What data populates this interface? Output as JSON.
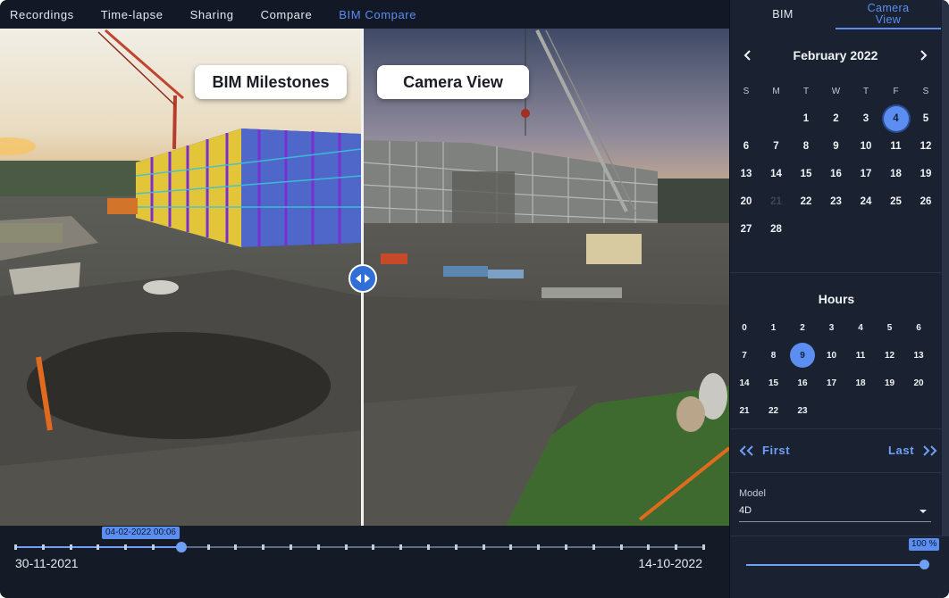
{
  "topnav": {
    "tabs": [
      {
        "label": "Recordings"
      },
      {
        "label": "Time-lapse"
      },
      {
        "label": "Sharing"
      },
      {
        "label": "Compare"
      },
      {
        "label": "BIM Compare",
        "active": true
      }
    ]
  },
  "viewer": {
    "left_label": "BIM Milestones",
    "right_label": "Camera View"
  },
  "timeline": {
    "current": "04-02-2022 00:06",
    "start": "30-11-2021",
    "end": "14-10-2022"
  },
  "panel": {
    "tabs": [
      {
        "label": "BIM"
      },
      {
        "label": "Camera View",
        "active": true
      }
    ],
    "calendar": {
      "month": "February 2022",
      "weekdays": [
        "S",
        "M",
        "T",
        "W",
        "T",
        "F",
        "S"
      ],
      "weeks": [
        [
          "",
          "",
          "1",
          "2",
          "3",
          "4",
          "5"
        ],
        [
          "6",
          "7",
          "8",
          "9",
          "10",
          "11",
          "12"
        ],
        [
          "13",
          "14",
          "15",
          "16",
          "17",
          "18",
          "19"
        ],
        [
          "20",
          "21",
          "22",
          "23",
          "24",
          "25",
          "26"
        ],
        [
          "27",
          "28",
          "",
          "",
          "",
          "",
          ""
        ]
      ],
      "selected_day": "4",
      "disabled_days": [
        "21"
      ]
    },
    "hours": {
      "title": "Hours",
      "rows": [
        [
          "0",
          "1",
          "2",
          "3",
          "4",
          "5",
          "6"
        ],
        [
          "7",
          "8",
          "9",
          "10",
          "11",
          "12",
          "13"
        ],
        [
          "14",
          "15",
          "16",
          "17",
          "18",
          "19",
          "20"
        ],
        [
          "21",
          "22",
          "23"
        ]
      ],
      "selected": "9"
    },
    "nav": {
      "first": "First",
      "last": "Last"
    },
    "model": {
      "label": "Model",
      "value": "4D"
    },
    "zoom": {
      "value": "100 %",
      "level_percent": 100
    }
  },
  "colors": {
    "accent": "#5b8ef0",
    "background": "#141b27",
    "panel": "#1a2232"
  },
  "icons": {
    "prev": "chevron-left-icon",
    "next": "chevron-right-icon",
    "first": "double-chevron-left-icon",
    "last": "double-chevron-right-icon",
    "handle": "split-handle-icon",
    "dropdown": "caret-down-icon"
  }
}
